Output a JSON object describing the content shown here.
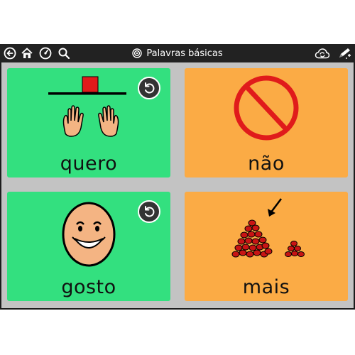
{
  "header": {
    "title": "Palavras básicas",
    "icons": [
      "back-arrow-icon",
      "home-icon",
      "speedometer-icon",
      "search-icon",
      "target-icon",
      "cloud-sync-icon",
      "edit-pencil-icon"
    ]
  },
  "cards": [
    {
      "label": "quero",
      "color": "#33e07f",
      "has_undo": true
    },
    {
      "label": "não",
      "color": "#fbab45",
      "has_undo": false
    },
    {
      "label": "gosto",
      "color": "#33e07f",
      "has_undo": true
    },
    {
      "label": "mais",
      "color": "#fbab45",
      "has_undo": false
    }
  ],
  "colors": {
    "topbar": "#222222",
    "board": "#c3c3c3",
    "green_card": "#33e07f",
    "orange_card": "#fbab45"
  }
}
